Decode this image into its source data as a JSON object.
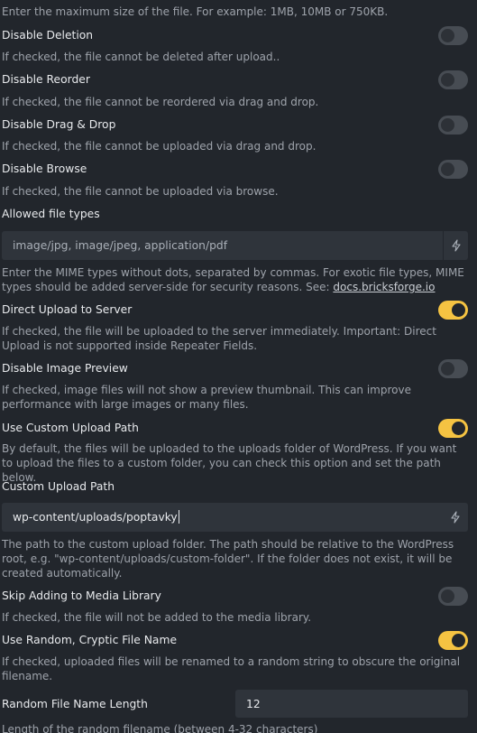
{
  "max_size": {
    "description": "Enter the maximum size of the file. For example: 1MB, 10MB or 750KB."
  },
  "disable_deletion": {
    "label": "Disable Deletion",
    "description": "If checked, the file cannot be deleted after upload..",
    "checked": false
  },
  "disable_reorder": {
    "label": "Disable Reorder",
    "description": "If checked, the file cannot be reordered via drag and drop.",
    "checked": false
  },
  "disable_drag_drop": {
    "label": "Disable Drag & Drop",
    "description": "If checked, the file cannot be uploaded via drag and drop.",
    "checked": false
  },
  "disable_browse": {
    "label": "Disable Browse",
    "description": "If checked, the file cannot be uploaded via browse.",
    "checked": false
  },
  "allowed_types": {
    "label": "Allowed file types",
    "placeholder": "image/jpg, image/jpeg, application/pdf",
    "description": "Enter the MIME types without dots, separated by commas. For exotic file types, MIME types should be added server-side for security reasons. See: ",
    "link_text": "docs.bricksforge.io",
    "icon": "bolt-icon"
  },
  "direct_upload": {
    "label": "Direct Upload to Server",
    "description": "If checked, the file will be uploaded to the server immediately. Important: Direct Upload is not supported inside Repeater Fields.",
    "checked": true
  },
  "disable_preview": {
    "label": "Disable Image Preview",
    "description": "If checked, image files will not show a preview thumbnail. This can improve performance with large images or many files.",
    "checked": false
  },
  "custom_path_toggle": {
    "label": "Use Custom Upload Path",
    "description": "By default, the files will be uploaded to the uploads folder of WordPress. If you want to upload the files to a custom folder, you can check this option and set the path below.",
    "checked": true
  },
  "custom_path": {
    "label": "Custom Upload Path",
    "value": "wp-content/uploads/poptavky",
    "description": "The path to the custom upload folder. The path should be relative to the WordPress root, e.g. \"wp-content/uploads/custom-folder\". If the folder does not exist, it will be created automatically.",
    "icon": "bolt-icon"
  },
  "skip_media": {
    "label": "Skip Adding to Media Library",
    "description": "If checked, the file will not be added to the media library.",
    "checked": false
  },
  "random_name": {
    "label": "Use Random, Cryptic File Name",
    "description": "If checked, uploaded files will be renamed to a random string to obscure the original filename.",
    "checked": true
  },
  "random_length": {
    "label": "Random File Name Length",
    "value": "12",
    "description": "Length of the random filename (between 4-32 characters)"
  },
  "colors": {
    "background": "#22262c",
    "accent": "#f5c342",
    "input_bg": "#2f343b",
    "toggle_off": "#474c53"
  }
}
